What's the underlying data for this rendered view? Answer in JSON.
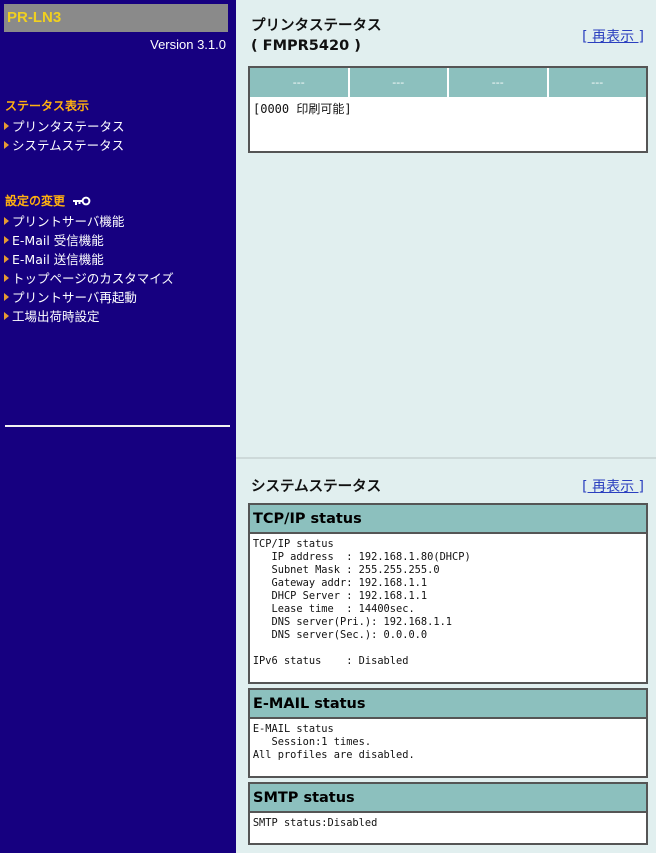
{
  "sidebar": {
    "brand": "PR-LN3",
    "version": "Version 3.1.0",
    "status_heading": "ステータス表示",
    "status_items": [
      {
        "label": "プリンタステータス"
      },
      {
        "label": "システムステータス"
      }
    ],
    "settings_heading": "設定の変更",
    "settings_icon": "key-icon",
    "settings_items": [
      {
        "label": "プリントサーバ機能"
      },
      {
        "label": "E-Mail 受信機能"
      },
      {
        "label": "E-Mail 送信機能"
      },
      {
        "label": "トップページのカスタマイズ"
      },
      {
        "label": "プリントサーバ再起動"
      },
      {
        "label": "工場出荷時設定"
      }
    ]
  },
  "printer_status": {
    "title": "プリンタステータス",
    "model": "( FMPR5420 )",
    "refresh_label": "[ 再表示 ]",
    "columns": [
      "---",
      "---",
      "---",
      "---"
    ],
    "message": "[0000 印刷可能]"
  },
  "system_status": {
    "title": "システムステータス",
    "refresh_label": "[ 再表示 ]",
    "tcpip": {
      "title": "TCP/IP status",
      "body": "TCP/IP status\n   IP address  : 192.168.1.80(DHCP)\n   Subnet Mask : 255.255.255.0\n   Gateway addr: 192.168.1.1\n   DHCP Server : 192.168.1.1\n   Lease time  : 14400sec.\n   DNS server(Pri.): 192.168.1.1\n   DNS server(Sec.): 0.0.0.0\n\nIPv6 status    : Disabled"
    },
    "email": {
      "title": "E-MAIL status",
      "body": "E-MAIL status\n   Session:1 times.\nAll profiles are disabled."
    },
    "smtp": {
      "title": "SMTP status",
      "body": "SMTP status:Disabled"
    }
  },
  "colors": {
    "sidebar_bg": "#160080",
    "brand_text": "#f0d020",
    "heading_text": "#ffb010",
    "panel_bg": "#e1efef",
    "table_header_bg": "#8cc0be",
    "link": "#2a3fbf"
  }
}
